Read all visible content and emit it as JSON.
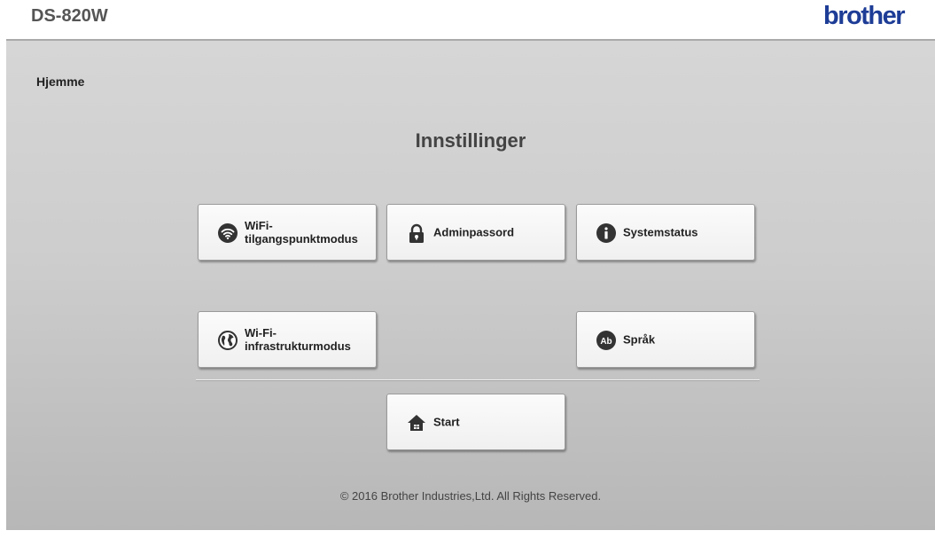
{
  "header": {
    "model": "DS-820W",
    "brand": "brother"
  },
  "breadcrumb": "Hjemme",
  "page_title": "Innstillinger",
  "tiles": [
    {
      "line1": "WiFi-",
      "line2": "tilgangspunktmodus",
      "icon": "wifi-icon"
    },
    {
      "label": "Adminpassord",
      "icon": "lock-icon"
    },
    {
      "label": "Systemstatus",
      "icon": "info-icon"
    },
    {
      "line1": "Wi-Fi-",
      "line2": "infrastrukturmodus",
      "icon": "globe-icon"
    },
    {
      "label": "Språk",
      "icon": "language-icon",
      "icon_text": "Ab"
    },
    {
      "label": "Start",
      "icon": "home-icon"
    }
  ],
  "footer": "© 2016 Brother Industries,Ltd. All Rights Reserved.",
  "colors": {
    "brand": "#1d3c96",
    "icon": "#333333"
  }
}
